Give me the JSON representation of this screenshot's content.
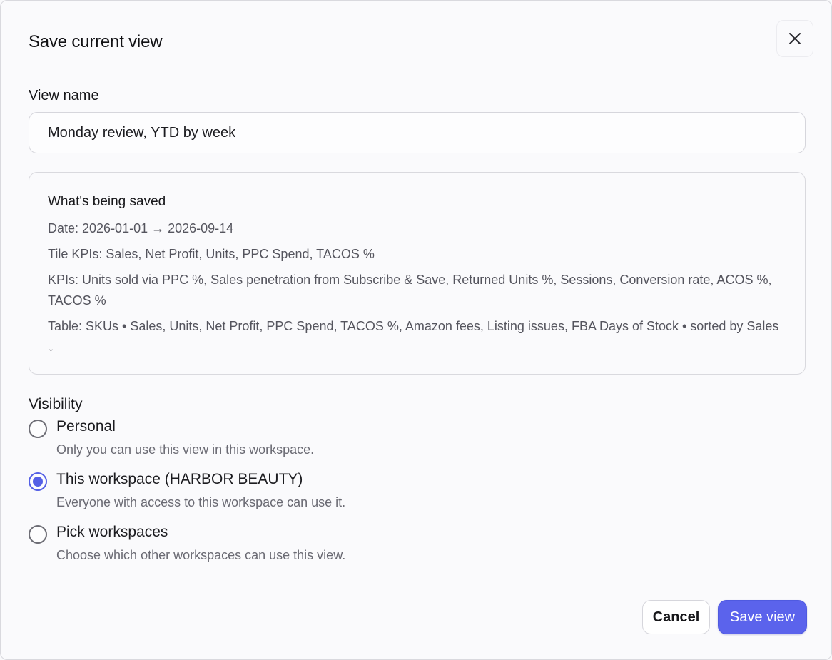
{
  "dialog": {
    "title": "Save current view",
    "close_icon": "close-icon"
  },
  "view_name": {
    "label": "View name",
    "value": "Monday review, YTD by week"
  },
  "summary": {
    "heading": "What's being saved",
    "lines": [
      "Date: 2026-01-01 → 2026-09-14",
      "Tile KPIs: Sales, Net Profit, Units, PPC Spend, TACOS %",
      "KPIs: Units sold via PPC %, Sales penetration from Subscribe & Save, Returned Units %, Sessions, Conversion rate, ACOS %, TACOS %",
      "Table: SKUs • Sales, Units, Net Profit, PPC Spend, TACOS %, Amazon fees, Listing issues, FBA Days of Stock • sorted by Sales ↓"
    ]
  },
  "visibility": {
    "label": "Visibility",
    "options": [
      {
        "title": "Personal",
        "description": "Only you can use this view in this workspace.",
        "checked": false
      },
      {
        "title": "This workspace (HARBOR BEAUTY)",
        "description": "Everyone with access to this workspace can use it.",
        "checked": true
      },
      {
        "title": "Pick workspaces",
        "description": "Choose which other workspaces can use this view.",
        "checked": false
      }
    ]
  },
  "actions": {
    "cancel_label": "Cancel",
    "save_label": "Save view"
  },
  "colors": {
    "accent": "#5b63ec",
    "radio_selected": "#5560e6",
    "muted_text": "#55555e"
  }
}
